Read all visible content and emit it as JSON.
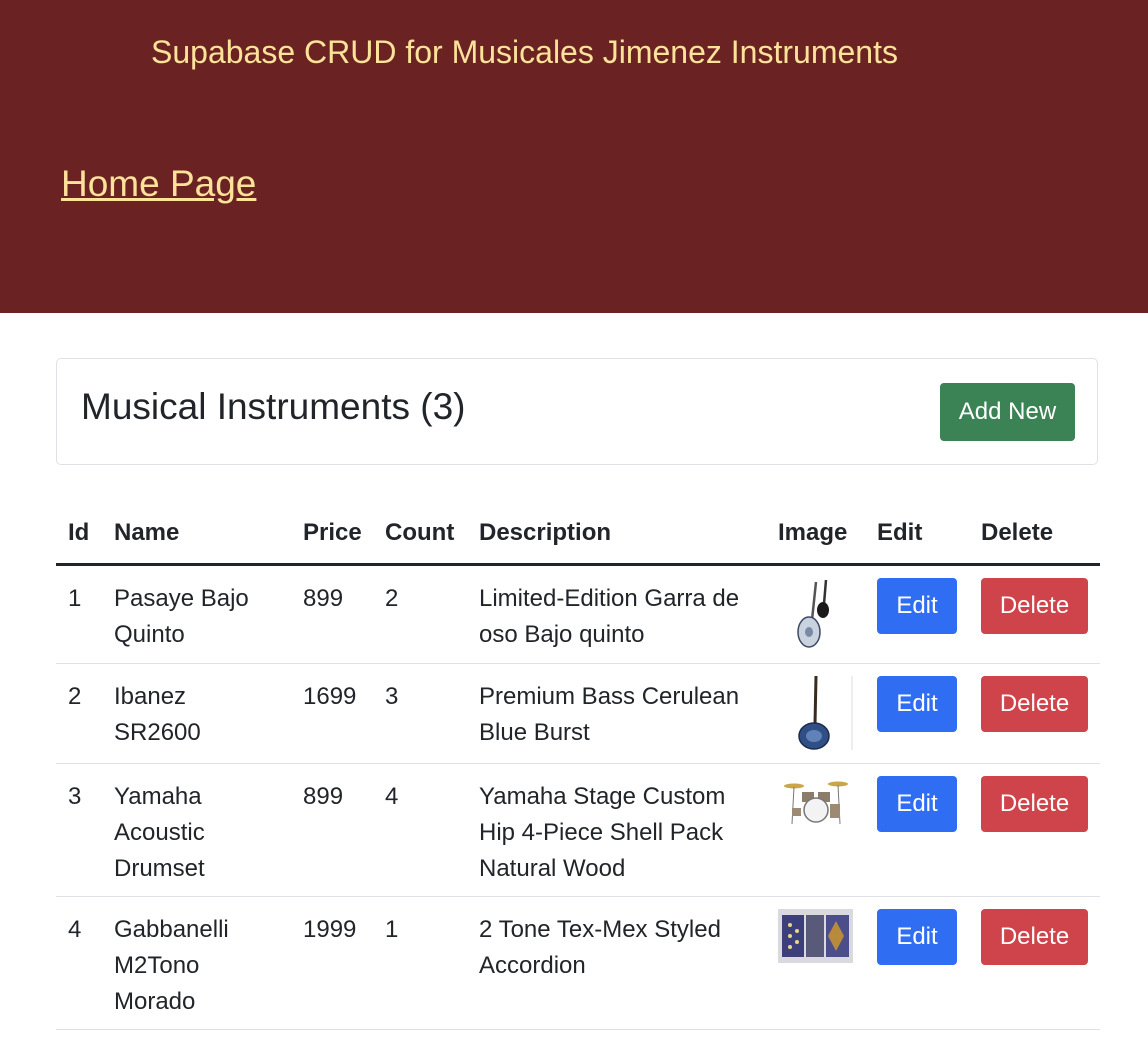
{
  "header": {
    "title": "Supabase CRUD for Musicales Jimenez Instruments",
    "home_link": "Home Page"
  },
  "card": {
    "title": "Musical Instruments (3)",
    "add_button": "Add New"
  },
  "table": {
    "columns": [
      "Id",
      "Name",
      "Price",
      "Count",
      "Description",
      "Image",
      "Edit",
      "Delete"
    ],
    "rows": [
      {
        "id": "1",
        "name": "Pasaye Bajo Quinto",
        "price": "899",
        "count": "2",
        "description": "Limited-Edition Garra de oso Bajo quinto",
        "image": "bajo-quinto-guitars-image",
        "edit": "Edit",
        "delete": "Delete"
      },
      {
        "id": "2",
        "name": "Ibanez SR2600",
        "price": "1699",
        "count": "3",
        "description": "Premium Bass Cerulean Blue Burst",
        "image": "bass-guitar-image",
        "edit": "Edit",
        "delete": "Delete"
      },
      {
        "id": "3",
        "name": "Yamaha Acoustic Drumset",
        "price": "899",
        "count": "4",
        "description": "Yamaha Stage Custom Hip 4-Piece Shell Pack Natural Wood",
        "image": "drumset-image",
        "edit": "Edit",
        "delete": "Delete"
      },
      {
        "id": "4",
        "name": "Gabbanelli M2Tono Morado",
        "price": "1999",
        "count": "1",
        "description": "2 Tone Tex-Mex Styled Accordion",
        "image": "accordion-image",
        "edit": "Edit",
        "delete": "Delete"
      }
    ]
  },
  "colors": {
    "header_bg": "#6a2322",
    "header_text": "#fde39a",
    "add_button": "#3b8254",
    "edit_button": "#2f6ef3",
    "delete_button": "#cf434a"
  }
}
